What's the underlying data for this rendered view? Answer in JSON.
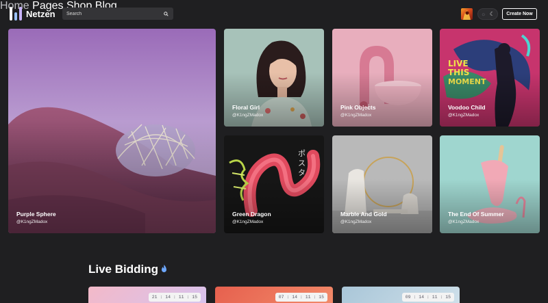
{
  "brand": {
    "name": "Netzen"
  },
  "search": {
    "placeholder": "Search"
  },
  "nav": {
    "items": [
      "Home",
      "Pages",
      "Shop",
      "Blog"
    ],
    "active": "Home"
  },
  "header": {
    "create_label": "Create Now",
    "theme_icons": [
      "sun-icon",
      "moon-icon"
    ]
  },
  "cards": [
    {
      "title": "Purple Sphere",
      "handle": "@K1ngZMadox"
    },
    {
      "title": "Floral Girl",
      "handle": "@K1ngZMadox"
    },
    {
      "title": "Pink Objects",
      "handle": "@K1ngZMadox"
    },
    {
      "title": "Voodoo Child",
      "handle": "@K1ngZMadox"
    },
    {
      "title": "Green Dragon",
      "handle": "@K1ngZMadox"
    },
    {
      "title": "Marble And Gold",
      "handle": "@K1ngZMadox"
    },
    {
      "title": "The End Of Summer",
      "handle": "@K1ngZMadox"
    }
  ],
  "live_bidding": {
    "title": "Live Bidding",
    "timers": [
      "21 : 14 : 11 : 15",
      "07 : 14 : 11 : 15",
      "09 : 14 : 11 : 15"
    ]
  },
  "colors": {
    "background": "#1f1f21",
    "search_bg": "#343437",
    "accent_logo": [
      "#ffffff",
      "#8fb8ff",
      "#c9b4ff"
    ]
  }
}
